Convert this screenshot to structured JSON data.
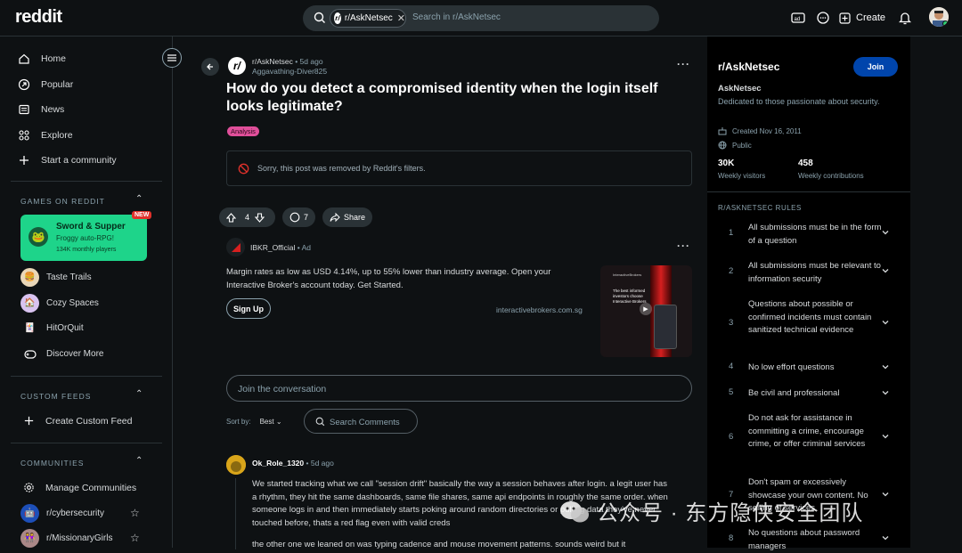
{
  "header": {
    "logo": "reddit",
    "search_chip": "r/AskNetsec",
    "search_placeholder": "Search in r/AskNetsec",
    "create_label": "Create"
  },
  "sidebar": {
    "nav": [
      {
        "label": "Home",
        "icon": "home-icon"
      },
      {
        "label": "Popular",
        "icon": "popular-icon"
      },
      {
        "label": "News",
        "icon": "news-icon"
      },
      {
        "label": "Explore",
        "icon": "explore-icon"
      },
      {
        "label": "Start a community",
        "icon": "plus-icon"
      }
    ],
    "games_heading": "GAMES ON REDDIT",
    "featured_game": {
      "title": "Sword & Supper",
      "subtitle": "Froggy auto-RPG!",
      "players": "134K monthly players",
      "badge": "NEW"
    },
    "games": [
      "Taste Trails",
      "Cozy Spaces",
      "HitOrQuit",
      "Discover More"
    ],
    "custom_feeds_heading": "CUSTOM FEEDS",
    "create_custom_feed": "Create Custom Feed",
    "communities_heading": "COMMUNITIES",
    "manage_communities": "Manage Communities",
    "communities": [
      "r/cybersecurity",
      "r/MissionaryGirls"
    ]
  },
  "post": {
    "subreddit": "r/AskNetsec",
    "age": "5d ago",
    "author": "Aggavathing-Diver825",
    "title": "How do you detect a compromised identity when the login itself looks legitimate?",
    "flair": "Analysis",
    "removed_notice": "Sorry, this post was removed by Reddit's filters.",
    "votes": "4",
    "comments": "7",
    "share_label": "Share"
  },
  "ad": {
    "advertiser": "IBKR_Official",
    "tag": "Ad",
    "body": "Margin rates as low as USD 4.14%, up to 55% lower than industry average. Open your Interactive Broker's account today. Get Started.",
    "cta": "Sign Up",
    "url": "interactivebrokers.com.sg",
    "thumb_brand": "InteractiveBrokers",
    "thumb_text": "The best informed investors choose Interactive Brokers"
  },
  "comments": {
    "join_placeholder": "Join the conversation",
    "sort_label": "Sort by:",
    "sort_value": "Best",
    "search_placeholder": "Search Comments",
    "first": {
      "author": "Ok_Role_1320",
      "age": "5d ago",
      "body": "We started tracking what we call \"session drift\" basically the way a session behaves after login. a legit user has a rhythm, they hit the same dashboards, same file shares, same api endpoints in roughly the same order. when someone logs in and then immediately starts poking around random directories or pulling data they've never touched before, thats a red flag even with valid creds",
      "body2": "the other one we leaned on was typing cadence and mouse movement patterns. sounds weird but it"
    }
  },
  "community": {
    "title": "r/AskNetsec",
    "join_label": "Join",
    "name": "AskNetsec",
    "description": "Dedicated to those passionate about security.",
    "created": "Created Nov 16, 2011",
    "visibility": "Public",
    "visitors": "30K",
    "visitors_label": "Weekly visitors",
    "contributions": "458",
    "contributions_label": "Weekly contributions",
    "rules_heading": "R/ASKNETSEC RULES",
    "rules": [
      "All submissions must be in the form of a question",
      "All submissions must be relevant to information security",
      "Questions about possible or confirmed incidents must contain sanitized technical evidence",
      "No low effort questions",
      "Be civil and professional",
      "Do not ask for assistance in committing a crime, encourage crime, or offer criminal services",
      "Don't spam or excessively showcase your own content. No selling of services",
      "No questions about password managers"
    ]
  },
  "watermark": "公众号 · 东方隐侠安全团队"
}
